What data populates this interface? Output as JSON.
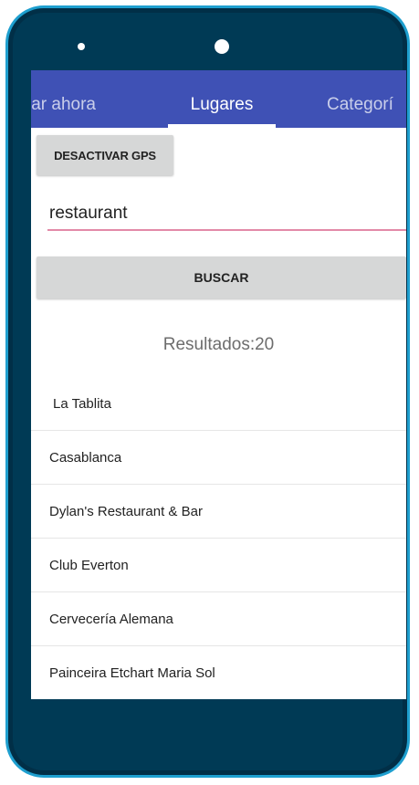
{
  "tabs": [
    {
      "label": "lar ahora"
    },
    {
      "label": "Lugares"
    },
    {
      "label": "Categorí"
    }
  ],
  "gps_button_label": "DESACTIVAR GPS",
  "search": {
    "value": "restaurant"
  },
  "search_button_label": "BUSCAR",
  "results_count": "Resultados:20",
  "results": [
    "La Tablita",
    "Casablanca",
    "Dylan's Restaurant & Bar",
    "Club Everton",
    "Cervecería Alemana",
    "Painceira Etchart Maria Sol"
  ],
  "colors": {
    "device_frame": "#003a55",
    "device_outline": "#1e9fcf",
    "tab_bar": "#3f51b5",
    "input_underline": "#e38aa8",
    "button_gray": "#d6d7d7"
  }
}
